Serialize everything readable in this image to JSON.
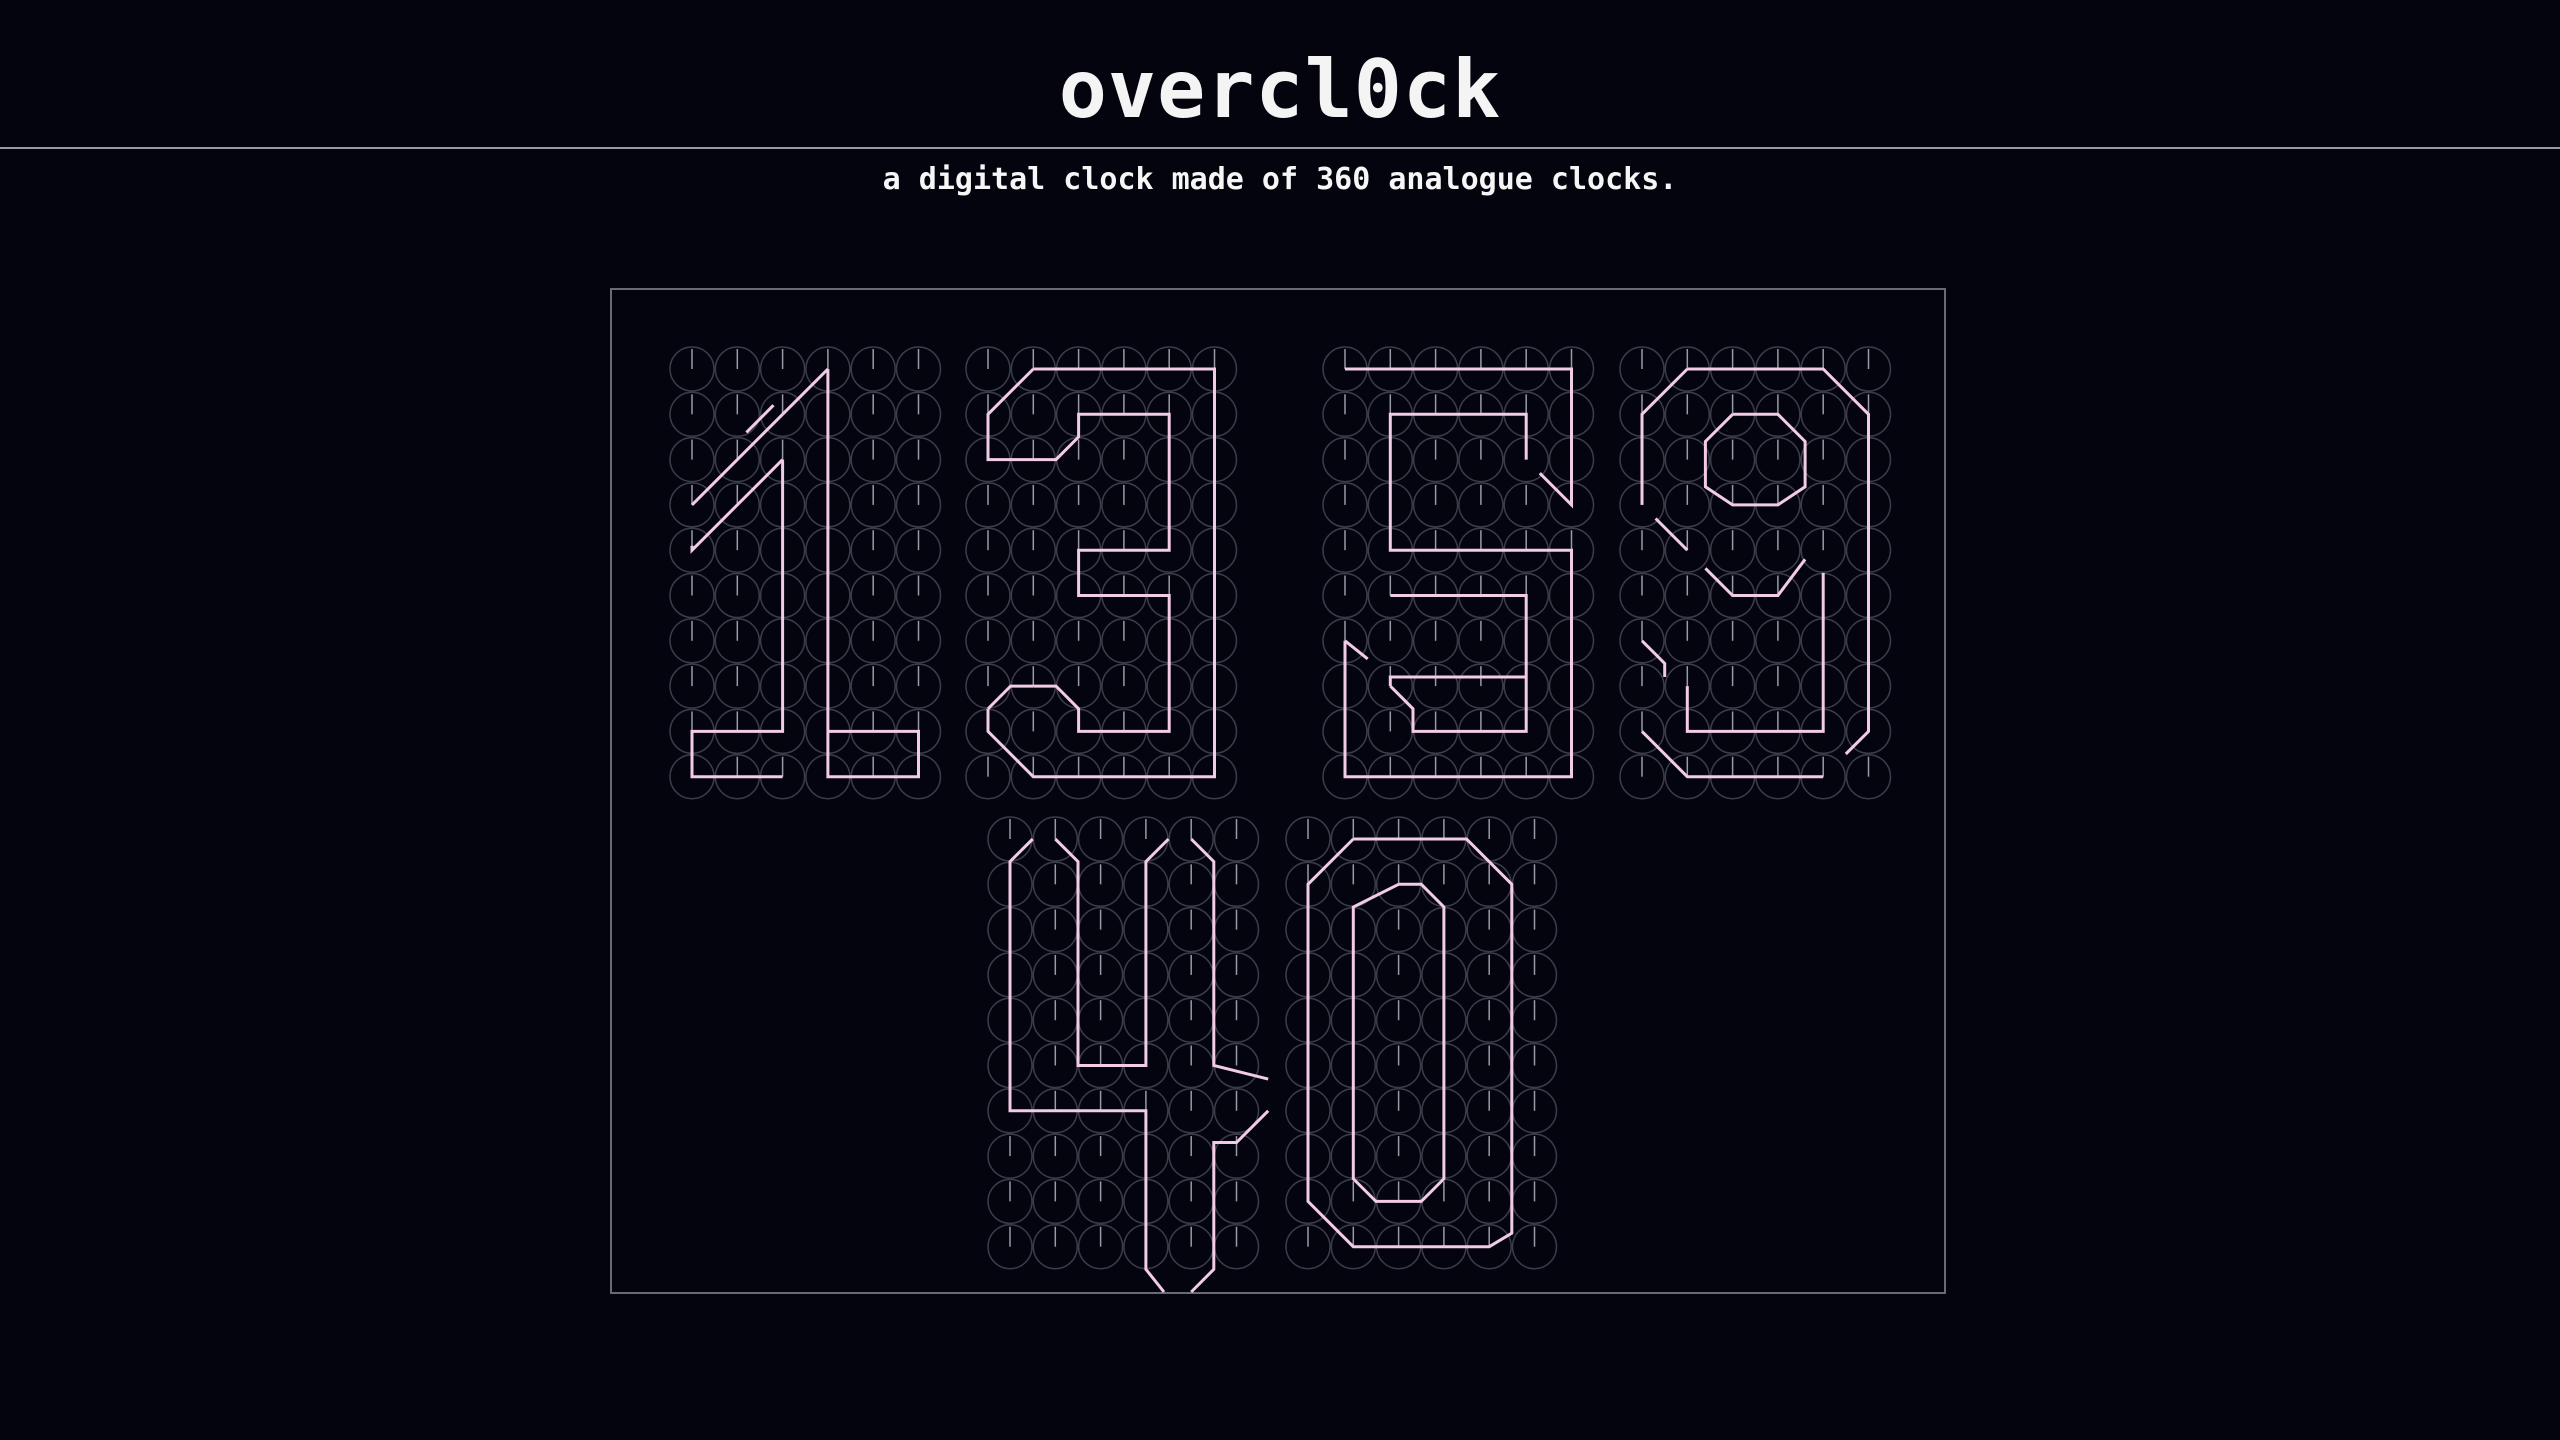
{
  "header": {
    "title": "overcl0ck",
    "subtitle": "a digital clock made of 360 analogue clocks."
  },
  "clock": {
    "time": "13:59:40",
    "digits": [
      "1",
      "3",
      "5",
      "9",
      "4",
      "0"
    ],
    "clock_count": 360,
    "colors": {
      "background": "#03040e",
      "face_outline": "#3c3c48",
      "idle_hand": "#9a9aa6",
      "digit_hand": "#f2cbe4"
    }
  }
}
